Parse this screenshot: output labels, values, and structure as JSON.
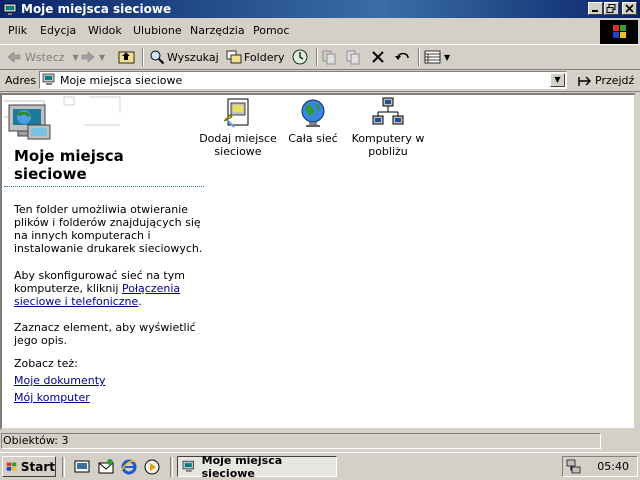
{
  "window": {
    "title": "Moje miejsca sieciowe",
    "controls": [
      "minimize",
      "restore",
      "close"
    ]
  },
  "menu": [
    "Plik",
    "Edycja",
    "Widok",
    "Ulubione",
    "Narzędzia",
    "Pomoc"
  ],
  "toolbar": {
    "back_label": "Wstecz",
    "search_label": "Wyszukaj",
    "folders_label": "Foldery"
  },
  "address": {
    "label": "Adres",
    "value": "Moje miejsca sieciowe",
    "go_label": "Przejdź"
  },
  "leftpane": {
    "title": "Moje miejsca sieciowe",
    "description": "Ten folder umożliwia otwieranie plików i folderów znajdujących się na innych komputerach i instalowanie drukarek sieciowych.",
    "config_text": "Aby skonfigurować sieć na tym komputerze, kliknij ",
    "config_link": "Połączenia sieciowe i telefoniczne",
    "config_end": ".",
    "select_hint": "Zaznacz element, aby wyświetlić jego opis.",
    "see_also_label": "Zobacz też:",
    "see_also_links": [
      "Moje dokumenty",
      "Mój komputer"
    ]
  },
  "items": [
    {
      "label": "Dodaj miejsce sieciowe",
      "icon": "add-network-place-icon"
    },
    {
      "label": "Cała sieć",
      "icon": "globe-icon"
    },
    {
      "label": "Komputery w pobliżu",
      "icon": "network-computers-icon"
    }
  ],
  "status": {
    "text": "Obiektów: 3"
  },
  "taskbar": {
    "start_label": "Start",
    "task_label": "Moje miejsca sieciowe",
    "clock": "05:40"
  },
  "colors": {
    "title_bar": "#0a246a",
    "face": "#d4d0c8",
    "link": "#00008b"
  }
}
